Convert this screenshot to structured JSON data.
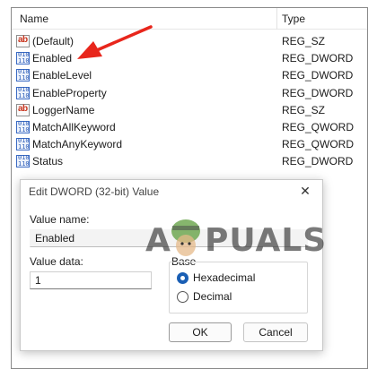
{
  "list": {
    "headers": {
      "name": "Name",
      "type": "Type"
    },
    "rows": [
      {
        "name": "(Default)",
        "type": "REG_SZ",
        "icon": "string-value-icon"
      },
      {
        "name": "Enabled",
        "type": "REG_DWORD",
        "icon": "binary-value-icon"
      },
      {
        "name": "EnableLevel",
        "type": "REG_DWORD",
        "icon": "binary-value-icon"
      },
      {
        "name": "EnableProperty",
        "type": "REG_DWORD",
        "icon": "binary-value-icon"
      },
      {
        "name": "LoggerName",
        "type": "REG_SZ",
        "icon": "string-value-icon"
      },
      {
        "name": "MatchAllKeyword",
        "type": "REG_QWORD",
        "icon": "binary-value-icon"
      },
      {
        "name": "MatchAnyKeyword",
        "type": "REG_QWORD",
        "icon": "binary-value-icon"
      },
      {
        "name": "Status",
        "type": "REG_DWORD",
        "icon": "binary-value-icon"
      }
    ]
  },
  "dialog": {
    "title": "Edit DWORD (32-bit) Value",
    "close_glyph": "✕",
    "value_name_label": "Value name:",
    "value_name": "Enabled",
    "value_data_label": "Value data:",
    "value_data": "1",
    "base_label": "Base",
    "base_options": [
      {
        "label": "Hexadecimal",
        "checked": true
      },
      {
        "label": "Decimal",
        "checked": false
      }
    ],
    "ok_label": "OK",
    "cancel_label": "Cancel"
  },
  "watermark": {
    "letters": [
      "A",
      "PUALS"
    ]
  },
  "colors": {
    "arrow": "#e8261c",
    "accent": "#1a5fb4",
    "string_icon": "#c9361f",
    "binary_icon": "#2f5fb8"
  }
}
